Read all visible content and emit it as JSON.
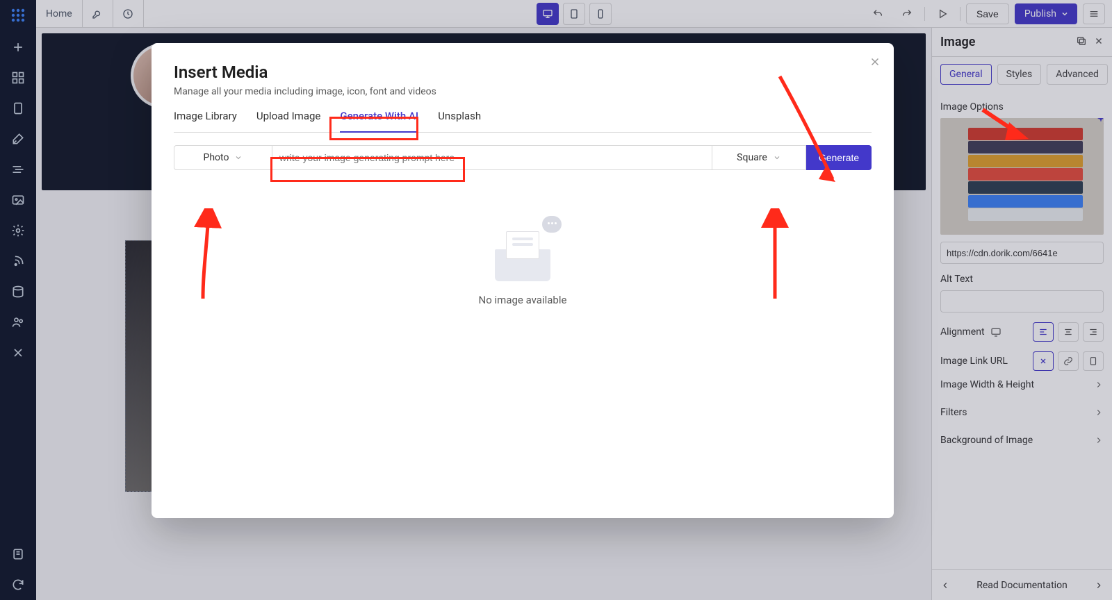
{
  "topbar": {
    "home": "Home",
    "save": "Save",
    "publish": "Publish"
  },
  "rpanel": {
    "title": "Image",
    "tabs": {
      "general": "General",
      "styles": "Styles",
      "advanced": "Advanced"
    },
    "image_options": "Image Options",
    "url_value": "https://cdn.dorik.com/6641e",
    "alt_label": "Alt Text",
    "alignment": "Alignment",
    "link_url": "Image Link URL",
    "wh": "Image Width & Height",
    "filters": "Filters",
    "bg": "Background of Image",
    "doc": "Read Documentation"
  },
  "modal": {
    "title": "Insert Media",
    "subtitle": "Manage all your media including image, icon, font and videos",
    "tabs": {
      "library": "Image Library",
      "upload": "Upload Image",
      "ai": "Generate With AI",
      "unsplash": "Unsplash"
    },
    "type_select": "Photo",
    "prompt_placeholder": "write your image generating prompt here",
    "aspect_select": "Square",
    "generate": "Generate",
    "empty": "No image available"
  }
}
